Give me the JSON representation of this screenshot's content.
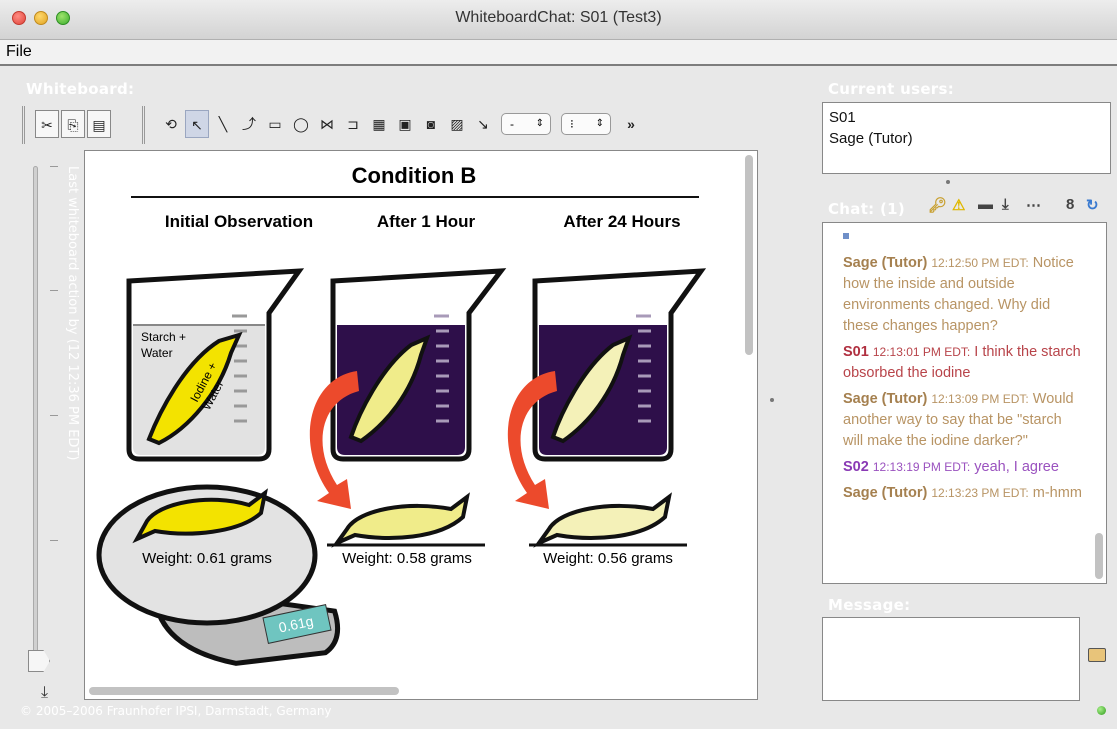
{
  "window": {
    "title": "WhiteboardChat: S01 (Test3)"
  },
  "menu": {
    "file": "File"
  },
  "whiteboard": {
    "label": "Whiteboard:",
    "last_action": "Last whiteboard action by   (12 12:36 PM EDT)",
    "copyright": "© 2005–2006 Fraunhofer IPSI, Darmstadt, Germany",
    "toolbar": {
      "cut_icon": "scissors-icon",
      "copy_icon": "copy-icon",
      "paste_icon": "paste-icon",
      "line_width_value": "-",
      "line_style_value": "⁝",
      "overflow": "»"
    },
    "canvas": {
      "title": "Condition B",
      "columns": [
        "Initial Observation",
        "After 1 Hour",
        "After 24 Hours"
      ],
      "beaker1_label": "Starch + Water",
      "bag1_label": "Iodine + Water",
      "weights": [
        "Weight: 0.61 grams",
        "Weight: 0.58 grams",
        "Weight: 0.56 grams"
      ],
      "scale_display": "0.61g",
      "colors": {
        "iodine": "#f3e300",
        "faded": "#f0ec8a",
        "pale": "#f4f1b8",
        "starch_dark": "#2e0f4a",
        "arrow": "#ec4a2c"
      }
    }
  },
  "users": {
    "label": "Current users:",
    "list": [
      "S01",
      "Sage (Tutor)"
    ]
  },
  "chat": {
    "label": "Chat: (1)",
    "icons": [
      "key-icon",
      "bell-icon",
      "block-icon",
      "download-icon",
      "more-icon",
      "person-icon",
      "refresh-icon"
    ],
    "messages": [
      {
        "role": "tutor",
        "sender": "Sage (Tutor)",
        "time": "12:12:50 PM EDT:",
        "text": "Notice how the inside and outside environments changed. Why did these changes happen?"
      },
      {
        "role": "s01",
        "sender": "S01",
        "time": "12:13:01 PM EDT:",
        "text": "I think the starch obsorbed the iodine"
      },
      {
        "role": "tutor",
        "sender": "Sage (Tutor)",
        "time": "12:13:09 PM EDT:",
        "text": "Would another way to say that be \"starch will make the iodine darker?\""
      },
      {
        "role": "s02",
        "sender": "S02",
        "time": "12:13:19 PM EDT:",
        "text": "yeah, I agree"
      },
      {
        "role": "tutor",
        "sender": "Sage (Tutor)",
        "time": "12:13:23 PM EDT:",
        "text": "m-hmm"
      }
    ]
  },
  "message": {
    "label": "Message:",
    "value": ""
  }
}
